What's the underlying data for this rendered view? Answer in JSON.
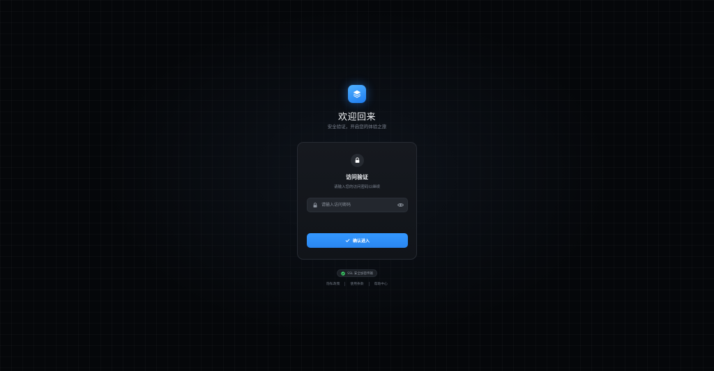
{
  "brand": {
    "logo_icon": "layers-icon",
    "title": "欢迎回来",
    "subtitle": "安全验证，开启您的体验之旅"
  },
  "card": {
    "lock_icon": "lock-icon",
    "title": "访问验证",
    "description": "请输入您的访问密码以继续",
    "password_field": {
      "value": "",
      "placeholder": "请输入访问密码",
      "leading_icon": "lock-icon",
      "toggle_icon": "eye-icon"
    },
    "submit": {
      "icon": "check-icon",
      "label": "确认进入"
    }
  },
  "ssl_badge": {
    "icon": "shield-check-icon",
    "label": "SSL 安全加密传输"
  },
  "footer_links": [
    {
      "label": "隐私政策"
    },
    {
      "label": "使用条款"
    },
    {
      "label": "帮助中心"
    }
  ],
  "colors": {
    "background": "#05070a",
    "accent": "#2e8cff",
    "card": "#14171c",
    "ssl_green": "#3ecf6a"
  }
}
